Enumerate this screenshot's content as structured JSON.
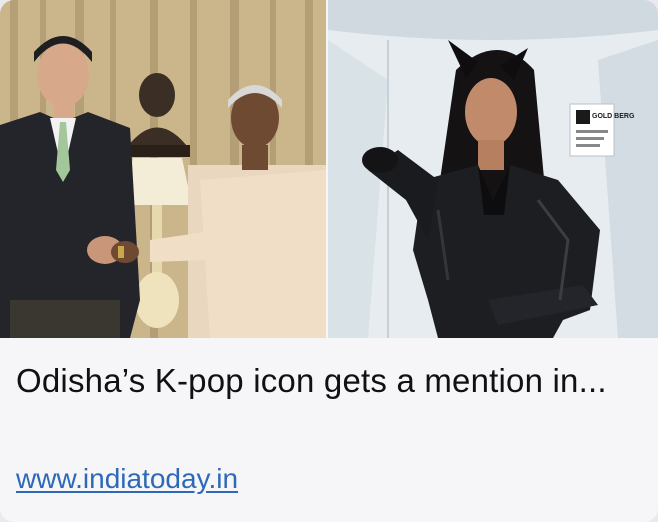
{
  "link_preview": {
    "title": "Odisha’s K-pop icon gets a mention in...",
    "domain": "www.indiatoday.in",
    "images": [
      {
        "name": "photo-handshake",
        "description": "Two people shaking hands in front of a bust statue"
      },
      {
        "name": "photo-leather-outfit",
        "description": "Woman in black leather outfit with cat-ear headband"
      }
    ],
    "sign_text": "GOLD BERG"
  },
  "colors": {
    "link": "#2e68b8",
    "title": "#111114",
    "card_background": "#f6f6f8"
  }
}
